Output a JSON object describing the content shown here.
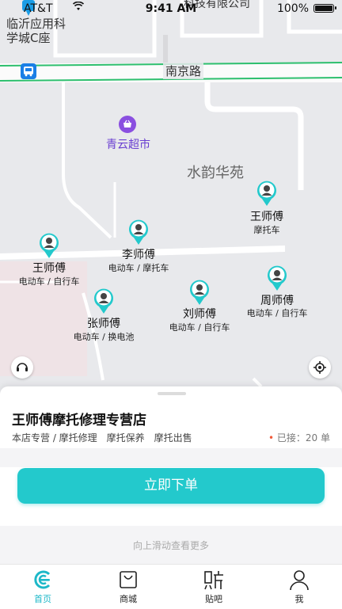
{
  "status_bar": {
    "carrier": "AT&T",
    "time": "9:41 AM",
    "battery": "100%"
  },
  "map": {
    "top_label": "科技有限公司",
    "poi_block": [
      "临沂应用科",
      "学城C座"
    ],
    "road_name": "南京路",
    "market": {
      "name": "青云超市",
      "icon": "shopping-basket-icon",
      "color": "#8a4fe0"
    },
    "area_name": "水韵华苑",
    "line_color": "#2dbf6e"
  },
  "mechanics": [
    {
      "name": "王师傅",
      "tags": "摩托车"
    },
    {
      "name": "李师傅",
      "tags": "电动车 / 摩托车"
    },
    {
      "name": "王师傅",
      "tags": "电动车 / 自行车"
    },
    {
      "name": "张师傅",
      "tags": "电动车 / 换电池"
    },
    {
      "name": "刘师傅",
      "tags": "电动车 / 自行车"
    },
    {
      "name": "周师傅",
      "tags": "电动车 / 自行车"
    }
  ],
  "pin_color": "#23c9cc",
  "controls": {
    "support_icon": "headset-icon",
    "locate_icon": "locate-icon"
  },
  "sheet": {
    "shop_name": "王师傅摩托修理专营店",
    "shop_desc": "本店专营 / 摩托修理　摩托保养　摩托出售",
    "orders": "已接：20 单",
    "order_button": "立即下单",
    "swipe_hint": "向上滑动查看更多"
  },
  "tabbar": {
    "active_color": "#1db8c8",
    "items": [
      {
        "label": "首页",
        "icon": "home-logo-icon",
        "active": true
      },
      {
        "label": "商城",
        "icon": "shopping-bag-icon",
        "active": false
      },
      {
        "label": "贴吧",
        "icon": "forum-icon",
        "active": false
      },
      {
        "label": "我",
        "icon": "user-icon",
        "active": false
      }
    ]
  }
}
